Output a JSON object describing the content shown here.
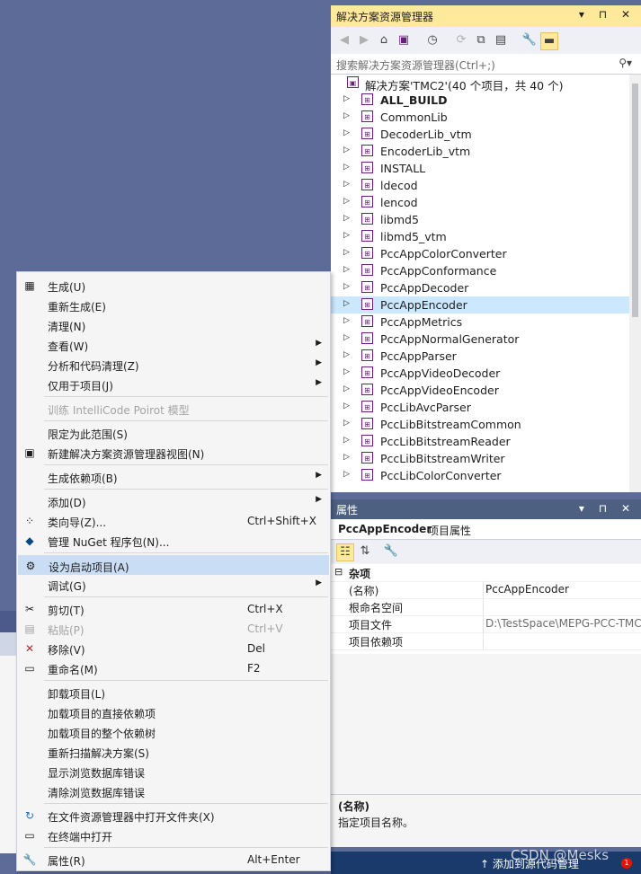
{
  "solution_explorer": {
    "title": "解决方案资源管理器",
    "title_icons": "▾ ⊓ ✕",
    "search_placeholder": "搜索解决方案资源管理器(Ctrl+;)",
    "solution_label": "解决方案'TMC2'(40 个项目，共 40 个)",
    "projects": [
      {
        "label": "ALL_BUILD",
        "bold": true
      },
      {
        "label": "CommonLib"
      },
      {
        "label": "DecoderLib_vtm"
      },
      {
        "label": "EncoderLib_vtm"
      },
      {
        "label": "INSTALL"
      },
      {
        "label": "ldecod"
      },
      {
        "label": "lencod"
      },
      {
        "label": "libmd5"
      },
      {
        "label": "libmd5_vtm"
      },
      {
        "label": "PccAppColorConverter"
      },
      {
        "label": "PccAppConformance"
      },
      {
        "label": "PccAppDecoder"
      },
      {
        "label": "PccAppEncoder",
        "selected": true
      },
      {
        "label": "PccAppMetrics"
      },
      {
        "label": "PccAppNormalGenerator"
      },
      {
        "label": "PccAppParser"
      },
      {
        "label": "PccAppVideoDecoder"
      },
      {
        "label": "PccAppVideoEncoder"
      },
      {
        "label": "PccLibAvcParser"
      },
      {
        "label": "PccLibBitstreamCommon"
      },
      {
        "label": "PccLibBitstreamReader"
      },
      {
        "label": "PccLibBitstreamWriter"
      },
      {
        "label": "PccLibColorConverter"
      }
    ]
  },
  "properties": {
    "title": "属性",
    "title_icons": "▾ ⊓ ✕",
    "object_name": "PccAppEncoder",
    "object_type": "项目属性",
    "category": "杂项",
    "rows": [
      {
        "name": "(名称)",
        "value": "PccAppEncoder"
      },
      {
        "name": "根命名空间",
        "value": ""
      },
      {
        "name": "项目文件",
        "value": "D:\\TestSpace\\MEPG-PCC-TMC"
      },
      {
        "name": "项目依赖项",
        "value": ""
      }
    ],
    "desc_title": "(名称)",
    "desc_text": "指定项目名称。"
  },
  "status_bar": {
    "text": "↑  添加到源代码管理",
    "watermark": "CSDN @Mesks",
    "badge": "1"
  },
  "context_menu": {
    "items": [
      {
        "type": "item",
        "icon": "build-icon",
        "glyph": "▦",
        "label": "生成(U)"
      },
      {
        "type": "item",
        "label": "重新生成(E)"
      },
      {
        "type": "item",
        "label": "清理(N)"
      },
      {
        "type": "item",
        "label": "查看(W)",
        "submenu": true
      },
      {
        "type": "item",
        "label": "分析和代码清理(Z)",
        "submenu": true
      },
      {
        "type": "item",
        "label": "仅用于项目(J)",
        "submenu": true
      },
      {
        "type": "sep"
      },
      {
        "type": "item",
        "label": "训练 IntelliCode Poirot 模型",
        "disabled": true
      },
      {
        "type": "sep"
      },
      {
        "type": "item",
        "label": "限定为此范围(S)"
      },
      {
        "type": "item",
        "icon": "new-view-icon",
        "glyph": "▣",
        "label": "新建解决方案资源管理器视图(N)"
      },
      {
        "type": "sep"
      },
      {
        "type": "item",
        "label": "生成依赖项(B)",
        "submenu": true
      },
      {
        "type": "sep"
      },
      {
        "type": "item",
        "label": "添加(D)",
        "submenu": true
      },
      {
        "type": "item",
        "icon": "class-wizard-icon",
        "glyph": "⁘",
        "label": "类向导(Z)...",
        "shortcut": "Ctrl+Shift+X"
      },
      {
        "type": "item",
        "icon": "nuget-icon",
        "glyph": "◆",
        "label": "管理 NuGet 程序包(N)..."
      },
      {
        "type": "sep"
      },
      {
        "type": "item",
        "icon": "gear-icon",
        "glyph": "⚙",
        "label": "设为启动项目(A)",
        "highlight": true
      },
      {
        "type": "item",
        "label": "调试(G)",
        "submenu": true
      },
      {
        "type": "sep"
      },
      {
        "type": "item",
        "icon": "scissors-icon",
        "glyph": "✂",
        "label": "剪切(T)",
        "shortcut": "Ctrl+X"
      },
      {
        "type": "item",
        "icon": "paste-icon",
        "glyph": "▤",
        "label": "粘贴(P)",
        "shortcut": "Ctrl+V",
        "disabled": true
      },
      {
        "type": "item",
        "icon": "remove-icon",
        "glyph": "✕",
        "label": "移除(V)",
        "shortcut": "Del"
      },
      {
        "type": "item",
        "icon": "rename-icon",
        "glyph": "▭",
        "label": "重命名(M)",
        "shortcut": "F2"
      },
      {
        "type": "sep"
      },
      {
        "type": "item",
        "label": "卸载项目(L)"
      },
      {
        "type": "item",
        "label": "加载项目的直接依赖项"
      },
      {
        "type": "item",
        "label": "加载项目的整个依赖树"
      },
      {
        "type": "item",
        "label": "重新扫描解决方案(S)"
      },
      {
        "type": "item",
        "label": "显示浏览数据库错误"
      },
      {
        "type": "item",
        "label": "清除浏览数据库错误"
      },
      {
        "type": "sep"
      },
      {
        "type": "item",
        "icon": "open-folder-icon",
        "glyph": "↻",
        "label": "在文件资源管理器中打开文件夹(X)"
      },
      {
        "type": "item",
        "icon": "terminal-icon",
        "glyph": "▭",
        "label": "在终端中打开"
      },
      {
        "type": "sep"
      },
      {
        "type": "item",
        "icon": "wrench-icon",
        "glyph": "🔧",
        "label": "属性(R)",
        "shortcut": "Alt+Enter"
      }
    ]
  }
}
